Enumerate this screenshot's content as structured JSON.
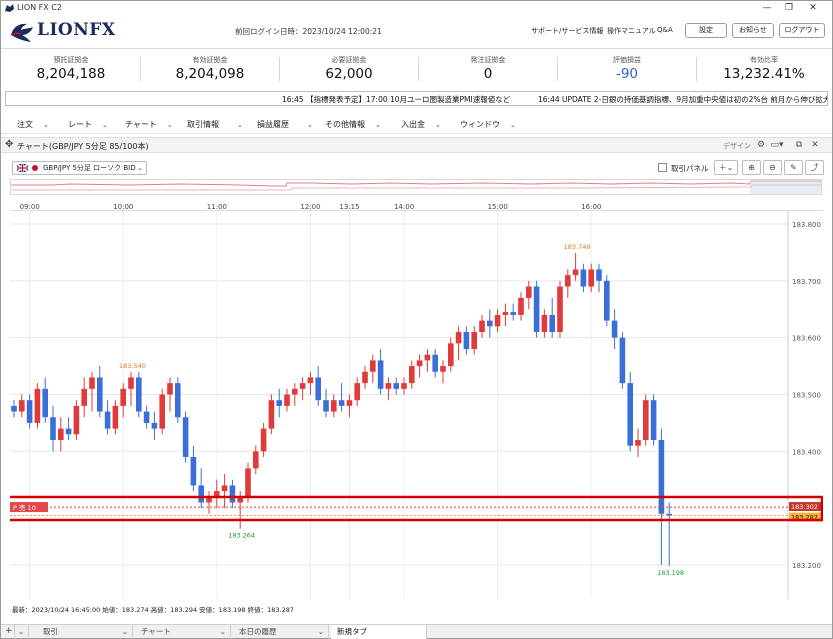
{
  "window": {
    "title": "LION FX C2",
    "min": "—",
    "restore": "❐",
    "close": "✕"
  },
  "header": {
    "logo": "LIONFX",
    "last_login": "前回ログイン日時：2023/10/24 12:00:21",
    "links": [
      "サポート/サービス情報",
      "操作マニュアル",
      "Q&A"
    ],
    "buttons": [
      "設定",
      "お知らせ",
      "ログアウト"
    ]
  },
  "account": [
    {
      "label": "預託証拠金",
      "value": "8,204,188"
    },
    {
      "label": "有効証拠金",
      "value": "8,204,098"
    },
    {
      "label": "必要証拠金",
      "value": "62,000"
    },
    {
      "label": "発注証拠金",
      "value": "0"
    },
    {
      "label": "評価損益",
      "value": "-90",
      "color": "#2f63c9"
    },
    {
      "label": "有効比率",
      "value": "13,232.41%"
    }
  ],
  "ticker": {
    "item1": "16:45 【指標発表予定】17:00 10月ユーロ圏製造業PMI速報値など",
    "item2": "16:44 UPDATE 2-日銀の持価基調指標、9月加重中央値は初の2%台 前月から伸び拡大"
  },
  "menu": [
    "注文",
    "レート",
    "チャート",
    "取引情報",
    "損益履歴",
    "その他情報",
    "入出金",
    "ウィンドウ"
  ],
  "panel": {
    "title": "チャート(GBP/JPY 5分足 85/100本)",
    "design": "デザイン"
  },
  "chart_toolbar": {
    "symbol": "GBP/JPY 5分足 ローソク BID",
    "panel_toggle": "取引パネル",
    "icons": [
      "crosshair-icon",
      "zoom-in-icon",
      "zoom-out-icon",
      "pen-icon",
      "indicator-icon"
    ]
  },
  "chart_data": {
    "type": "candlestick",
    "pair": "GBP/JPY",
    "timeframe": "5分足",
    "x_tick_labels": [
      "09:00",
      "10:00",
      "11:00",
      "12:00",
      "13:15",
      "14:00",
      "15:00",
      "16:00"
    ],
    "y_tick_labels": [
      "183.800",
      "183.700",
      "183.600",
      "183.500",
      "183.400",
      "183.300",
      "183.200"
    ],
    "ylim": [
      183.164,
      183.823
    ],
    "annotations": [
      {
        "text": "183.540",
        "kind": "high"
      },
      {
        "text": "183.264",
        "kind": "low"
      },
      {
        "text": "183.749",
        "kind": "high"
      },
      {
        "text": "183.198",
        "kind": "low"
      }
    ],
    "position": {
      "label": "売 10",
      "price_tag_sell": "183.302",
      "price_tag_current": "183.287"
    },
    "candles": [
      [
        183.48,
        183.49,
        183.46,
        183.47
      ],
      [
        183.47,
        183.5,
        183.46,
        183.49
      ],
      [
        183.49,
        183.5,
        183.44,
        183.45
      ],
      [
        183.45,
        183.52,
        183.44,
        183.51
      ],
      [
        183.51,
        183.53,
        183.45,
        183.46
      ],
      [
        183.46,
        183.48,
        183.4,
        183.42
      ],
      [
        183.42,
        183.46,
        183.4,
        183.44
      ],
      [
        183.44,
        183.46,
        183.42,
        183.43
      ],
      [
        183.43,
        183.49,
        183.42,
        183.48
      ],
      [
        183.48,
        183.53,
        183.46,
        183.51
      ],
      [
        183.51,
        183.54,
        183.47,
        183.53
      ],
      [
        183.53,
        183.55,
        183.46,
        183.47
      ],
      [
        183.47,
        183.49,
        183.43,
        183.44
      ],
      [
        183.44,
        183.49,
        183.43,
        183.48
      ],
      [
        183.48,
        183.52,
        183.46,
        183.51
      ],
      [
        183.51,
        183.54,
        183.48,
        183.53
      ],
      [
        183.53,
        183.54,
        183.46,
        183.47
      ],
      [
        183.47,
        183.48,
        183.44,
        183.45
      ],
      [
        183.45,
        183.47,
        183.42,
        183.44
      ],
      [
        183.44,
        183.51,
        183.43,
        183.5
      ],
      [
        183.5,
        183.53,
        183.47,
        183.52
      ],
      [
        183.52,
        183.53,
        183.45,
        183.46
      ],
      [
        183.46,
        183.47,
        183.38,
        183.39
      ],
      [
        183.39,
        183.41,
        183.33,
        183.34
      ],
      [
        183.34,
        183.37,
        183.3,
        183.31
      ],
      [
        183.31,
        183.33,
        183.29,
        183.32
      ],
      [
        183.32,
        183.35,
        183.3,
        183.33
      ],
      [
        183.33,
        183.36,
        183.3,
        183.34
      ],
      [
        183.34,
        183.35,
        183.3,
        183.31
      ],
      [
        183.31,
        183.33,
        183.264,
        183.32
      ],
      [
        183.32,
        183.38,
        183.31,
        183.37
      ],
      [
        183.37,
        183.41,
        183.36,
        183.4
      ],
      [
        183.4,
        183.45,
        183.39,
        183.44
      ],
      [
        183.44,
        183.5,
        183.43,
        183.49
      ],
      [
        183.49,
        183.51,
        183.46,
        183.48
      ],
      [
        183.48,
        183.51,
        183.47,
        183.5
      ],
      [
        183.5,
        183.52,
        183.48,
        183.51
      ],
      [
        183.51,
        183.53,
        183.49,
        183.52
      ],
      [
        183.52,
        183.54,
        183.5,
        183.53
      ],
      [
        183.53,
        183.55,
        183.48,
        183.49
      ],
      [
        183.49,
        183.51,
        183.46,
        183.47
      ],
      [
        183.47,
        183.5,
        183.46,
        183.49
      ],
      [
        183.49,
        183.52,
        183.47,
        183.48
      ],
      [
        183.48,
        183.5,
        183.46,
        183.49
      ],
      [
        183.49,
        183.53,
        183.48,
        183.52
      ],
      [
        183.52,
        183.55,
        183.51,
        183.54
      ],
      [
        183.54,
        183.57,
        183.52,
        183.56
      ],
      [
        183.56,
        183.58,
        183.5,
        183.51
      ],
      [
        183.51,
        183.53,
        183.49,
        183.52
      ],
      [
        183.52,
        183.53,
        183.5,
        183.51
      ],
      [
        183.51,
        183.53,
        183.5,
        183.52
      ],
      [
        183.52,
        183.56,
        183.51,
        183.55
      ],
      [
        183.55,
        183.57,
        183.53,
        183.56
      ],
      [
        183.56,
        183.58,
        183.54,
        183.57
      ],
      [
        183.57,
        183.58,
        183.53,
        183.54
      ],
      [
        183.54,
        183.56,
        183.52,
        183.55
      ],
      [
        183.55,
        183.6,
        183.54,
        183.59
      ],
      [
        183.59,
        183.62,
        183.56,
        183.61
      ],
      [
        183.61,
        183.62,
        183.57,
        183.58
      ],
      [
        183.58,
        183.62,
        183.57,
        183.61
      ],
      [
        183.61,
        183.64,
        183.6,
        183.63
      ],
      [
        183.63,
        183.65,
        183.6,
        183.62
      ],
      [
        183.62,
        183.65,
        183.61,
        183.64
      ],
      [
        183.64,
        183.66,
        183.62,
        183.645
      ],
      [
        183.645,
        183.66,
        183.63,
        183.64
      ],
      [
        183.64,
        183.68,
        183.63,
        183.67
      ],
      [
        183.67,
        183.7,
        183.65,
        183.69
      ],
      [
        183.69,
        183.7,
        183.6,
        183.61
      ],
      [
        183.61,
        183.65,
        183.6,
        183.64
      ],
      [
        183.64,
        183.67,
        183.6,
        183.61
      ],
      [
        183.61,
        183.7,
        183.6,
        183.69
      ],
      [
        183.69,
        183.72,
        183.67,
        183.71
      ],
      [
        183.71,
        183.749,
        183.7,
        183.72
      ],
      [
        183.72,
        183.73,
        183.68,
        183.69
      ],
      [
        183.69,
        183.73,
        183.68,
        183.72
      ],
      [
        183.72,
        183.73,
        183.68,
        183.7
      ],
      [
        183.7,
        183.71,
        183.62,
        183.63
      ],
      [
        183.63,
        183.65,
        183.58,
        183.6
      ],
      [
        183.6,
        183.61,
        183.51,
        183.52
      ],
      [
        183.52,
        183.54,
        183.4,
        183.41
      ],
      [
        183.41,
        183.44,
        183.39,
        183.42
      ],
      [
        183.42,
        183.5,
        183.41,
        183.49
      ],
      [
        183.49,
        183.5,
        183.41,
        183.42
      ],
      [
        183.42,
        183.44,
        183.2,
        183.29
      ],
      [
        183.29,
        183.31,
        183.198,
        183.287
      ]
    ]
  },
  "info_line": "最新：2023/10/24 16:45:00 始値：183.274 高値：183.294 安値：183.198 終値：183.287",
  "bottom_tabs": [
    "取引",
    "チャート",
    "本日の履歴",
    "新規タブ"
  ],
  "bottom_add": "+"
}
